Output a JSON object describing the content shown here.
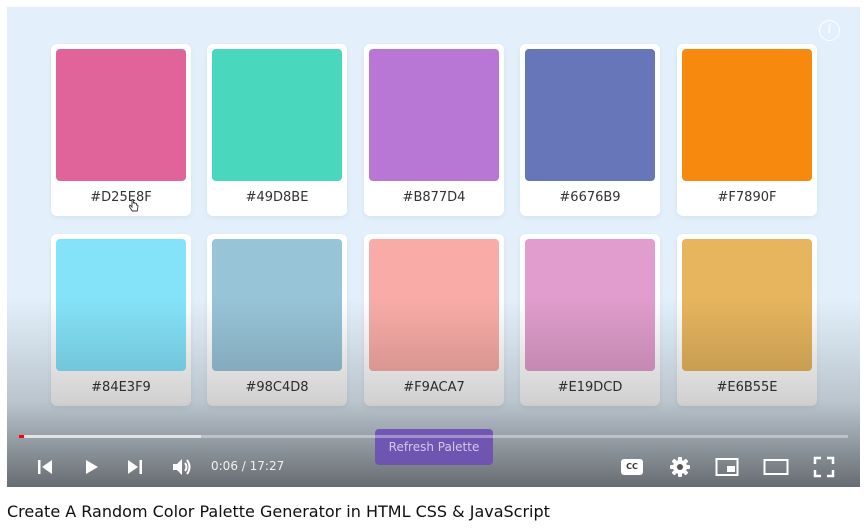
{
  "video": {
    "title": "Create A Random Color Palette Generator in HTML CSS & JavaScript",
    "current_time": "0:06",
    "time_separator": "/",
    "duration": "17:27",
    "progress_fraction": 0.0057,
    "loaded_fraction": 0.22,
    "progress_color": "#ff0000"
  },
  "palette": {
    "colors": [
      {
        "hex_label": "#D25E8F",
        "color": "#e0649a"
      },
      {
        "hex_label": "#49D8BE",
        "color": "#49d8be"
      },
      {
        "hex_label": "#B877D4",
        "color": "#b877d4"
      },
      {
        "hex_label": "#6676B9",
        "color": "#6676b9"
      },
      {
        "hex_label": "#F7890F",
        "color": "#f7890f"
      },
      {
        "hex_label": "#84E3F9",
        "color": "#84e3f9"
      },
      {
        "hex_label": "#98C4D8",
        "color": "#98c4d8"
      },
      {
        "hex_label": "#F9ACA7",
        "color": "#f9aca7"
      },
      {
        "hex_label": "#E19DCD",
        "color": "#e19dcd"
      },
      {
        "hex_label": "#E6B55E",
        "color": "#e6b55e"
      }
    ],
    "refresh_label": "Refresh Palette",
    "refresh_color": "#6d4fb5"
  },
  "controls": {
    "icons": [
      "previous-icon",
      "play-icon",
      "next-icon",
      "volume-icon",
      "captions-icon",
      "settings-icon",
      "miniplayer-icon",
      "theater-icon",
      "fullscreen-icon"
    ],
    "captions_label": "CC",
    "info_label": "i"
  }
}
